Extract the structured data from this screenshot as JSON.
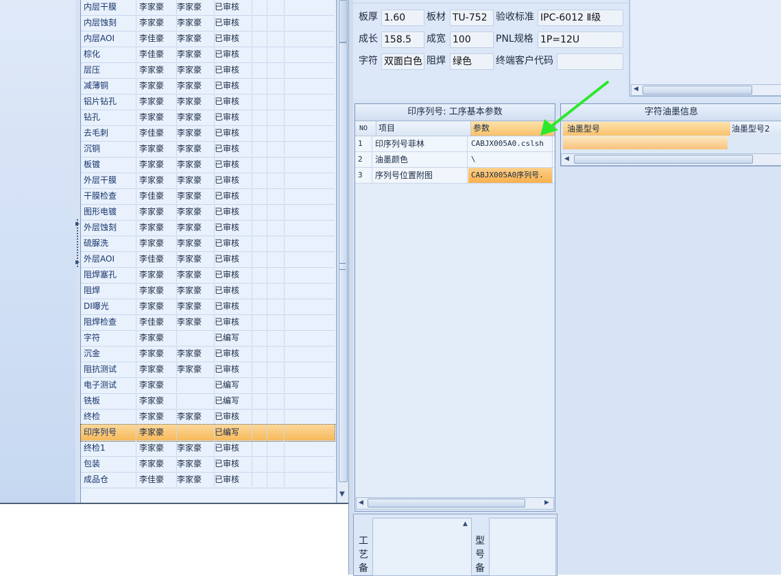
{
  "process_list": {
    "rows": [
      {
        "name": "内层干膜",
        "maker": "李家豪",
        "reviewer": "李家豪",
        "status": "已审核"
      },
      {
        "name": "内层蚀刻",
        "maker": "李家豪",
        "reviewer": "李家豪",
        "status": "已审核"
      },
      {
        "name": "内层AOI",
        "maker": "李佳豪",
        "reviewer": "李家豪",
        "status": "已审核"
      },
      {
        "name": "棕化",
        "maker": "李佳豪",
        "reviewer": "李家豪",
        "status": "已审核"
      },
      {
        "name": "层压",
        "maker": "李家豪",
        "reviewer": "李家豪",
        "status": "已审核"
      },
      {
        "name": "减薄铜",
        "maker": "李家豪",
        "reviewer": "李家豪",
        "status": "已审核"
      },
      {
        "name": "铝片钻孔",
        "maker": "李家豪",
        "reviewer": "李家豪",
        "status": "已审核"
      },
      {
        "name": "钻孔",
        "maker": "李家豪",
        "reviewer": "李家豪",
        "status": "已审核"
      },
      {
        "name": "去毛刺",
        "maker": "李佳豪",
        "reviewer": "李家豪",
        "status": "已审核"
      },
      {
        "name": "沉铜",
        "maker": "李家豪",
        "reviewer": "李家豪",
        "status": "已审核"
      },
      {
        "name": "板镀",
        "maker": "李家豪",
        "reviewer": "李家豪",
        "status": "已审核"
      },
      {
        "name": "外层干膜",
        "maker": "李家豪",
        "reviewer": "李家豪",
        "status": "已审核"
      },
      {
        "name": "干膜检查",
        "maker": "李佳豪",
        "reviewer": "李家豪",
        "status": "已审核"
      },
      {
        "name": "图形电镀",
        "maker": "李家豪",
        "reviewer": "李家豪",
        "status": "已审核"
      },
      {
        "name": "外层蚀刻",
        "maker": "李家豪",
        "reviewer": "李家豪",
        "status": "已审核"
      },
      {
        "name": "硫脲洗",
        "maker": "李家豪",
        "reviewer": "李家豪",
        "status": "已审核"
      },
      {
        "name": "外层AOI",
        "maker": "李佳豪",
        "reviewer": "李家豪",
        "status": "已审核"
      },
      {
        "name": "阻焊塞孔",
        "maker": "李家豪",
        "reviewer": "李家豪",
        "status": "已审核"
      },
      {
        "name": "阻焊",
        "maker": "李家豪",
        "reviewer": "李家豪",
        "status": "已审核"
      },
      {
        "name": "DI曝光",
        "maker": "李家豪",
        "reviewer": "李家豪",
        "status": "已审核"
      },
      {
        "name": "阻焊检查",
        "maker": "李佳豪",
        "reviewer": "李家豪",
        "status": "已审核"
      },
      {
        "name": "字符",
        "maker": "李家豪",
        "reviewer": "",
        "status": "已编写"
      },
      {
        "name": "沉金",
        "maker": "李家豪",
        "reviewer": "李家豪",
        "status": "已审核"
      },
      {
        "name": "阻抗测试",
        "maker": "李家豪",
        "reviewer": "李家豪",
        "status": "已审核"
      },
      {
        "name": "电子测试",
        "maker": "李家豪",
        "reviewer": "",
        "status": "已编写"
      },
      {
        "name": "铣板",
        "maker": "李家豪",
        "reviewer": "",
        "status": "已编写"
      },
      {
        "name": "终检",
        "maker": "李家豪",
        "reviewer": "李家豪",
        "status": "已审核"
      },
      {
        "name": "印序列号",
        "maker": "李家豪",
        "reviewer": "",
        "status": "已编写"
      },
      {
        "name": "终检1",
        "maker": "李家豪",
        "reviewer": "李家豪",
        "status": "已审核"
      },
      {
        "name": "包装",
        "maker": "李家豪",
        "reviewer": "李家豪",
        "status": "已审核"
      },
      {
        "name": "成品仓",
        "maker": "李佳豪",
        "reviewer": "李家豪",
        "status": "已审核"
      }
    ],
    "selected_index": 27
  },
  "info": {
    "board_thickness_label": "板厚",
    "board_thickness": "1.60",
    "material_label": "板材",
    "material": "TU-752",
    "standard_label": "验收标准",
    "standard": "IPC-6012 Ⅱ级",
    "length_label": "成长",
    "length": "158.5",
    "width_label": "成宽",
    "width": "100",
    "pnl_label": "PNL规格",
    "pnl": "1P=12U",
    "legend_label": "字符",
    "legend": "双面白色",
    "mask_label": "阻焊",
    "mask": "绿色",
    "customer_code_label": "终端客户代码",
    "customer_code": ""
  },
  "params": {
    "title": "印序列号: 工序基本参数",
    "col_no": "NO",
    "col_item": "项目",
    "col_param": "参数",
    "rows": [
      {
        "no": "1",
        "item": "印序列号菲林",
        "value": "CABJX005A0.cslsh"
      },
      {
        "no": "2",
        "item": "油墨颜色",
        "value": "\\"
      },
      {
        "no": "3",
        "item": "序列号位置附图",
        "value": "CABJX005A0序列号."
      }
    ]
  },
  "ink": {
    "title": "字符油墨信息",
    "col1": "油墨型号",
    "col2": "油墨型号2"
  },
  "memo": {
    "label1_chars": [
      "工",
      "艺",
      "备"
    ],
    "label2_chars": [
      "型",
      "号",
      "备"
    ]
  },
  "colors": {
    "annotation_arrow": "#2ee82e",
    "selection": "#f8b04c"
  }
}
